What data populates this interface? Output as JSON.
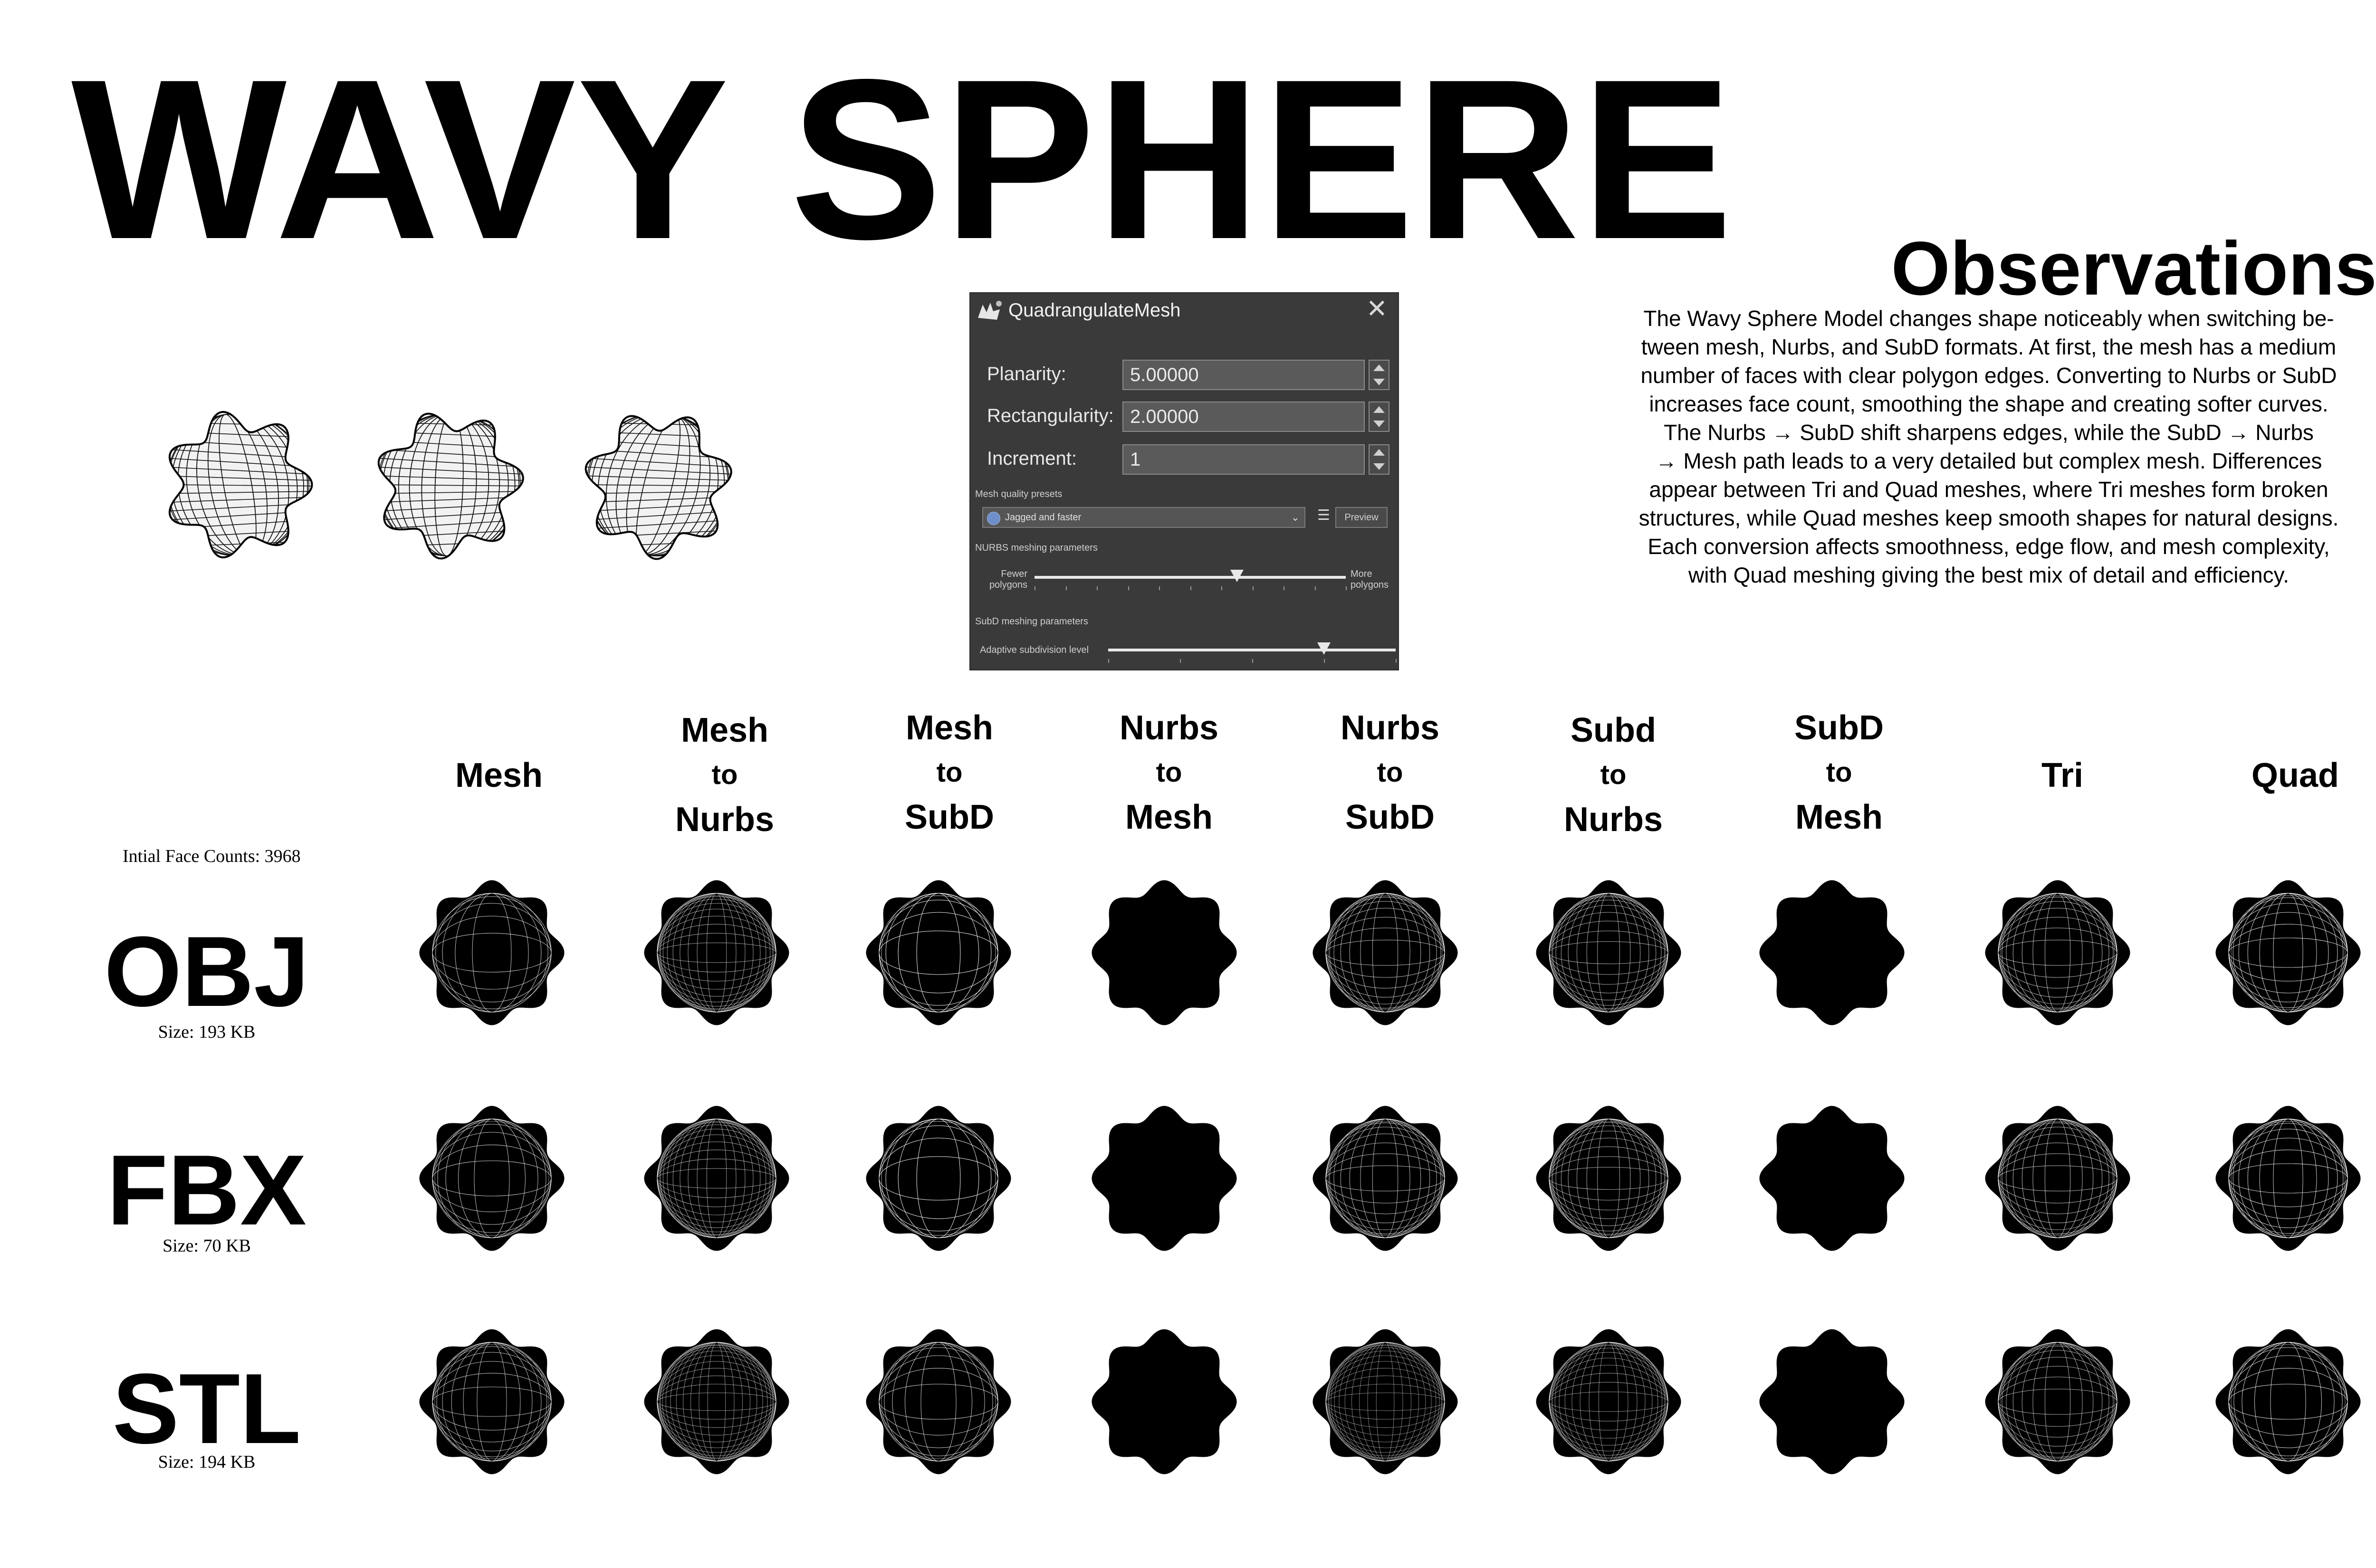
{
  "title": "WAVY SPHERE",
  "observations": {
    "heading": "Observations",
    "lines": [
      "The Wavy Sphere Model changes shape noticeably when switching be-",
      "tween mesh, Nurbs, and SubD formats. At first, the mesh has a medium",
      "number of faces with clear polygon edges. Converting to Nurbs or SubD",
      "increases face count, smoothing the shape and creating softer curves.",
      "The Nurbs → SubD shift sharpens edges, while the SubD → Nurbs",
      "→ Mesh path leads to a very detailed but complex mesh. Differences",
      "appear between Tri and Quad meshes, where Tri meshes form broken",
      "structures, while Quad meshes keep smooth shapes for natural designs.",
      "Each conversion affects smoothness, edge flow, and mesh complexity,",
      "with Quad meshing giving the best mix of detail and efficiency."
    ]
  },
  "dialog": {
    "title": "QuadrangulateMesh",
    "close_icon": "close-icon",
    "planarity_label": "Planarity:",
    "planarity_value": "5.00000",
    "rectangularity_label": "Rectangularity:",
    "rectangularity_value": "2.00000",
    "increment_label": "Increment:",
    "increment_value": "1",
    "mesh_quality_presets_label": "Mesh quality presets",
    "preset_value": "Jagged and faster",
    "preview_button": "Preview",
    "nurbs_section_label": "NURBS meshing parameters",
    "fewer_polygons": [
      "Fewer",
      "polygons"
    ],
    "more_polygons": [
      "More",
      "polygons"
    ],
    "nurbs_slider_level": 0.65,
    "subd_section_label": "SubD meshing parameters",
    "adaptive_label": "Adaptive subdivision level",
    "subd_slider_level": 0.75
  },
  "columns": [
    [
      "Mesh"
    ],
    [
      "Mesh",
      "to",
      "Nurbs"
    ],
    [
      "Mesh",
      "to",
      "SubD"
    ],
    [
      "Nurbs",
      "to",
      "Mesh"
    ],
    [
      "Nurbs",
      "to",
      "SubD"
    ],
    [
      "Subd",
      "to",
      "Nurbs"
    ],
    [
      "SubD",
      "to",
      "Mesh"
    ],
    [
      "Tri"
    ],
    [
      "Quad"
    ]
  ],
  "initial_face_count": "Intial Face Counts: 3968",
  "rows": [
    {
      "label": "OBJ",
      "size": "Size: 193 KB"
    },
    {
      "label": "FBX",
      "size": "Size: 70 KB"
    },
    {
      "label": "STL",
      "size": "Size: 194 KB"
    }
  ]
}
